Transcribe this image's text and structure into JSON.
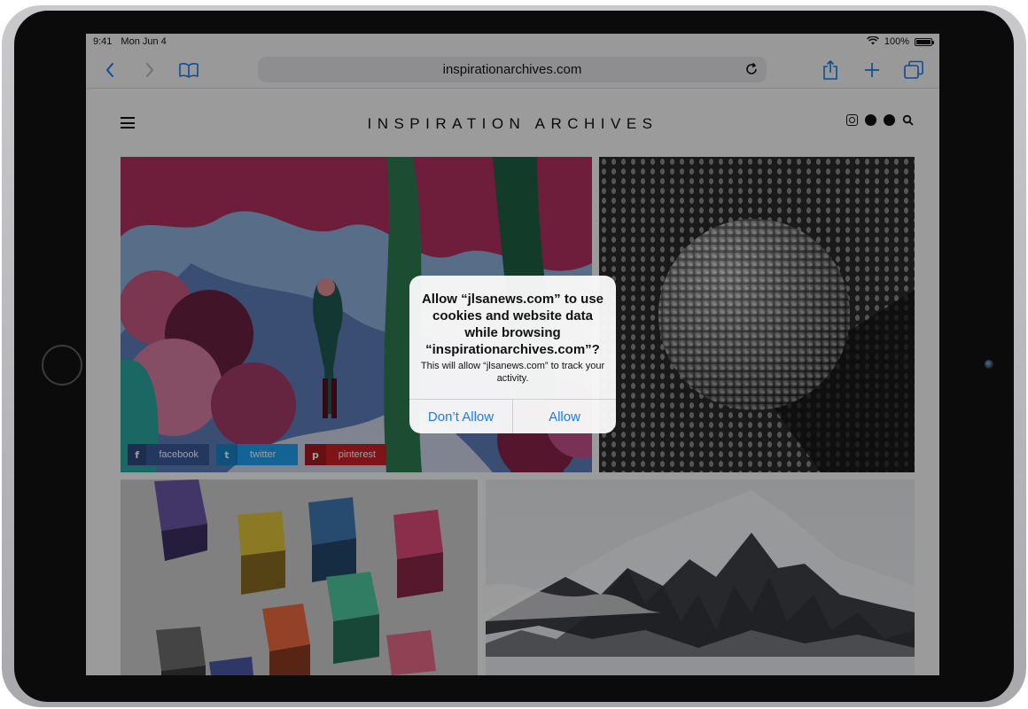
{
  "status_bar": {
    "time": "9:41",
    "date": "Mon Jun 4",
    "battery": "100%"
  },
  "browser": {
    "url": "inspirationarchives.com",
    "icons": {
      "back": "chevron-left-icon",
      "forward": "chevron-right-icon",
      "bookmarks": "book-icon",
      "reload": "reload-icon",
      "share": "share-icon",
      "new_tab": "plus-icon",
      "tabs": "tabs-icon"
    },
    "accent_color": "#1a7bf2"
  },
  "site": {
    "title": "INSPIRATION ARCHIVES",
    "social_icons": [
      "instagram-icon",
      "twitter-icon",
      "pinterest-icon",
      "search-icon"
    ],
    "share_buttons": [
      {
        "label": "facebook",
        "icon_glyph": "f",
        "color": "#3b5998"
      },
      {
        "label": "twitter",
        "icon_glyph": "t",
        "color": "#1da1f2"
      },
      {
        "label": "pinterest",
        "icon_glyph": "p",
        "color": "#cb2027"
      }
    ]
  },
  "alert": {
    "title": "Allow “jlsanews.com” to use cookies and website data while browsing “inspirationarchives.com”?",
    "message": "This will allow “jlsanews.com” to track your activity.",
    "buttons": {
      "deny": "Don’t Allow",
      "allow": "Allow"
    }
  }
}
